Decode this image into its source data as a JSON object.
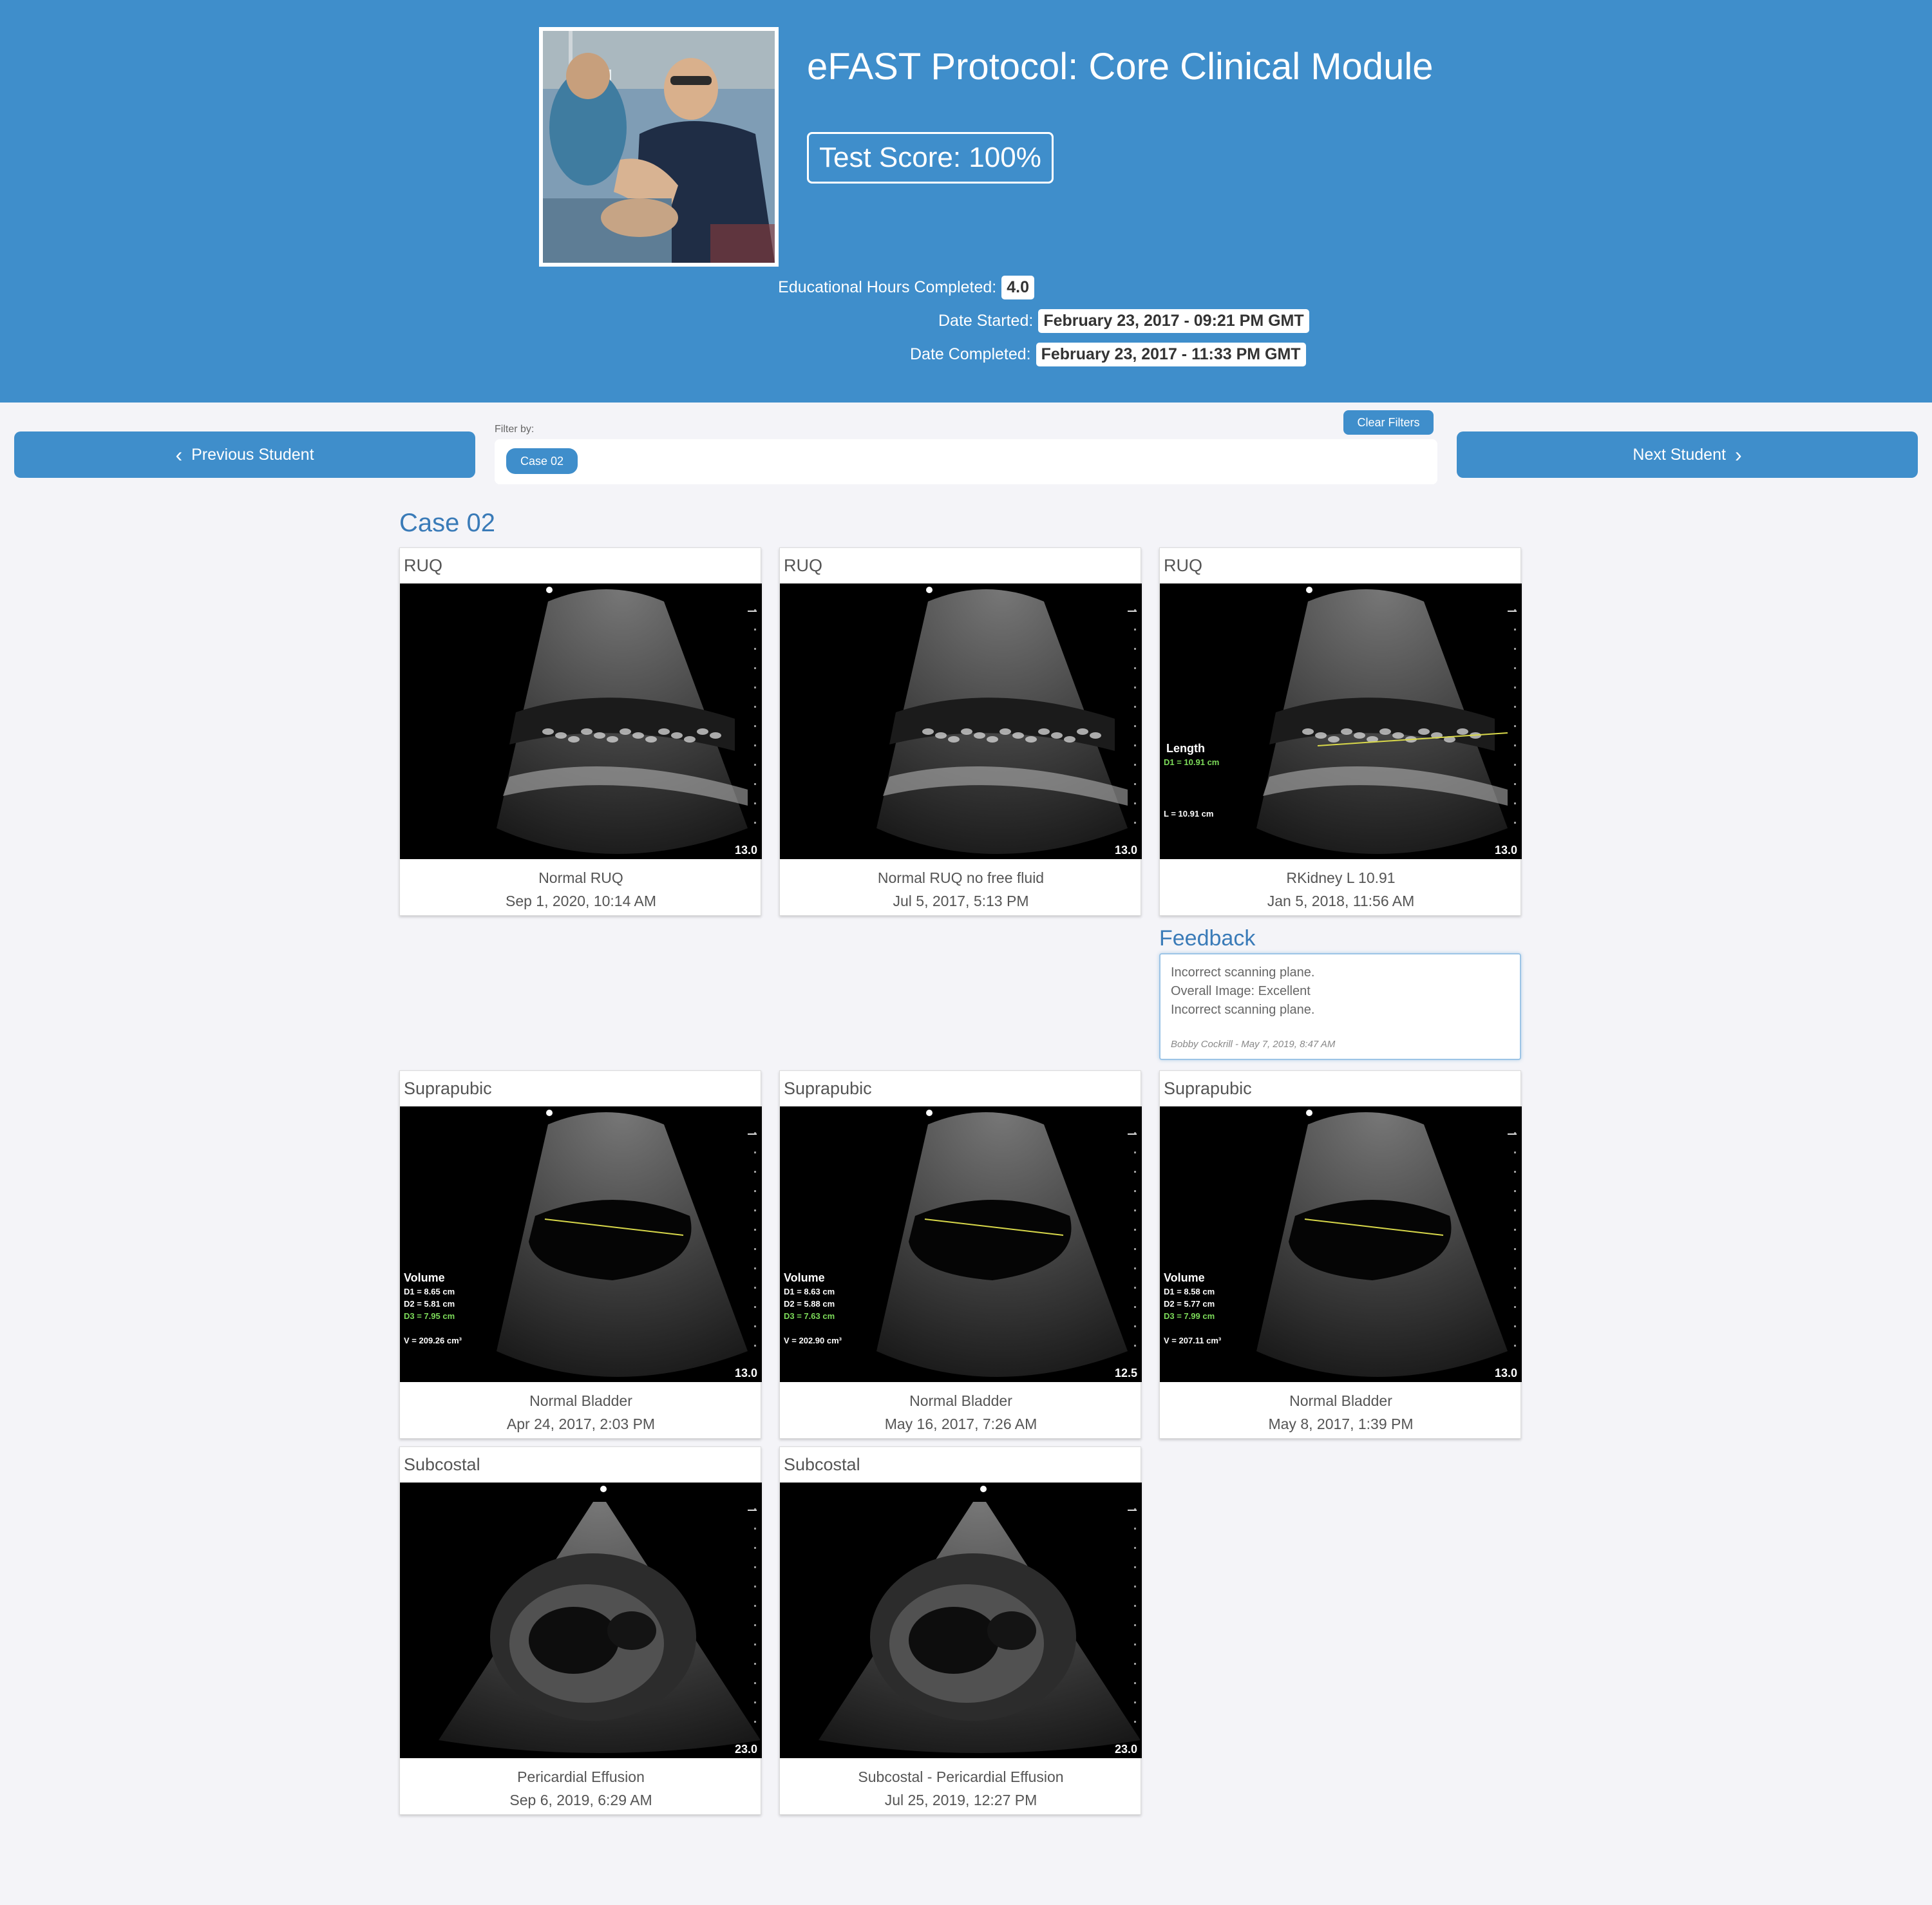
{
  "header": {
    "module_title": "eFAST Protocol: Core Clinical Module",
    "test_score": "Test Score: 100%",
    "stats": [
      {
        "label": "Educational Hours Completed:",
        "value": "4.0"
      },
      {
        "label": "Date Started:",
        "value": "February 23, 2017 - 09:21 PM GMT"
      },
      {
        "label": "Date Completed:",
        "value": "February 23, 2017 - 11:33 PM GMT"
      }
    ]
  },
  "nav": {
    "previous_label": "Previous Student",
    "next_label": "Next Student"
  },
  "filter": {
    "label": "Filter by:",
    "clear_label": "Clear Filters",
    "chips": [
      "Case 02"
    ]
  },
  "case": {
    "title": "Case 02",
    "cards": [
      {
        "label": "RUQ",
        "caption": "Normal RUQ",
        "date": "Sep 1, 2020, 10:14 AM",
        "depth": "13.0"
      },
      {
        "label": "RUQ",
        "caption": "Normal RUQ no free fluid",
        "date": "Jul 5, 2017, 5:13 PM",
        "depth": "13.0"
      },
      {
        "label": "RUQ",
        "caption": "RKidney L 10.91",
        "date": "Jan 5, 2018, 11:56 AM",
        "depth": "13.0",
        "measure": {
          "title": "Length",
          "d1": "D1 = 10.91 cm",
          "l": "L = 10.91 cm"
        }
      },
      {
        "label": "Suprapubic",
        "caption": "Normal Bladder",
        "date": "Apr 24, 2017, 2:03 PM",
        "depth": "13.0",
        "measure": {
          "title": "Volume",
          "d1": "D1 = 8.65 cm",
          "d2": "D2 = 5.81 cm",
          "d3": "D3 = 7.95 cm",
          "v": "V = 209.26 cm³"
        }
      },
      {
        "label": "Suprapubic",
        "caption": "Normal Bladder",
        "date": "May 16, 2017, 7:26 AM",
        "depth": "12.5",
        "measure": {
          "title": "Volume",
          "d1": "D1 = 8.63 cm",
          "d2": "D2 = 5.88 cm",
          "d3": "D3 = 7.63 cm",
          "v": "V = 202.90 cm³"
        }
      },
      {
        "label": "Suprapubic",
        "caption": "Normal Bladder",
        "date": "May 8, 2017, 1:39 PM",
        "depth": "13.0",
        "measure": {
          "title": "Volume",
          "d1": "D1 = 8.58 cm",
          "d2": "D2 = 5.77 cm",
          "d3": "D3 = 7.99 cm",
          "v": "V = 207.11 cm³"
        }
      },
      {
        "label": "Subcostal",
        "caption": "Pericardial Effusion",
        "date": "Sep 6, 2019, 6:29 AM",
        "depth": "23.0"
      },
      {
        "label": "Subcostal",
        "caption": "Subcostal - Pericardial Effusion",
        "date": "Jul 25, 2019, 12:27 PM",
        "depth": "23.0"
      }
    ],
    "feedback": {
      "title": "Feedback",
      "lines": [
        "Incorrect scanning plane.",
        "Overall Image: Excellent",
        "Incorrect scanning plane."
      ],
      "author": "Bobby Cockrill - May 7, 2019, 8:47 AM"
    }
  },
  "colors": {
    "header_bg": "#3f8ecb",
    "accent_text": "#3a7bb8",
    "page_bg": "#f4f4f8",
    "caliper": "#d8d84a",
    "measure_green": "#7ddc5a"
  },
  "icons": {
    "previous": "chevron-left-icon",
    "next": "chevron-right-icon"
  }
}
